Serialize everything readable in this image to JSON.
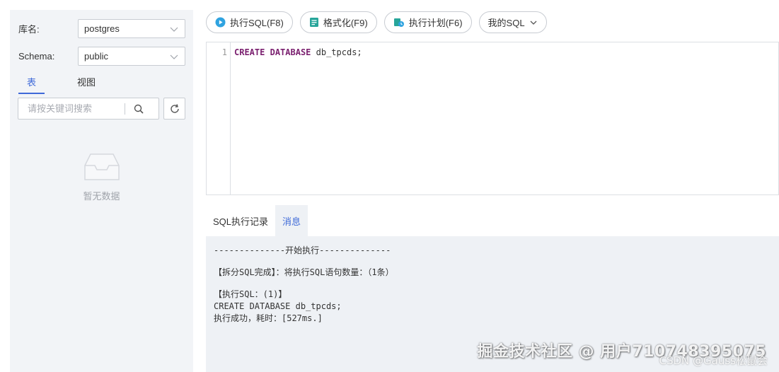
{
  "sidebar": {
    "db_label": "库名:",
    "db_value": "postgres",
    "schema_label": "Schema:",
    "schema_value": "public",
    "tabs": [
      {
        "label": "表",
        "active": true
      },
      {
        "label": "视图",
        "active": false
      }
    ],
    "search_placeholder": "请按关键词搜索",
    "empty_text": "暂无数据"
  },
  "toolbar": {
    "run_label": "执行SQL(F8)",
    "format_label": "格式化(F9)",
    "plan_label": "执行计划(F6)",
    "mysql_label": "我的SQL"
  },
  "editor": {
    "line_number": "1",
    "code_keyword1": "CREATE",
    "code_keyword2": "DATABASE",
    "code_rest": " db_tpcds;"
  },
  "results": {
    "tabs": [
      {
        "label": "SQL执行记录",
        "active": false
      },
      {
        "label": "消息",
        "active": true
      }
    ],
    "messages": {
      "start": "--------------开始执行--------------",
      "split": "【拆分SQL完成】：将执行SQL语句数量：（1条）",
      "exec_header": "【执行SQL：(1)】",
      "exec_sql": "CREATE DATABASE db_tpcds;",
      "exec_result": "执行成功，耗时：[527ms.]"
    }
  },
  "watermark": {
    "main": "掘金技术社区 @ 用户710748395075",
    "sub": "CSDN @Gauss松鼠会"
  },
  "colors": {
    "accent": "#3f6ad8",
    "panel_bg": "#f2f4f7",
    "message_bg": "#eef1f5"
  }
}
